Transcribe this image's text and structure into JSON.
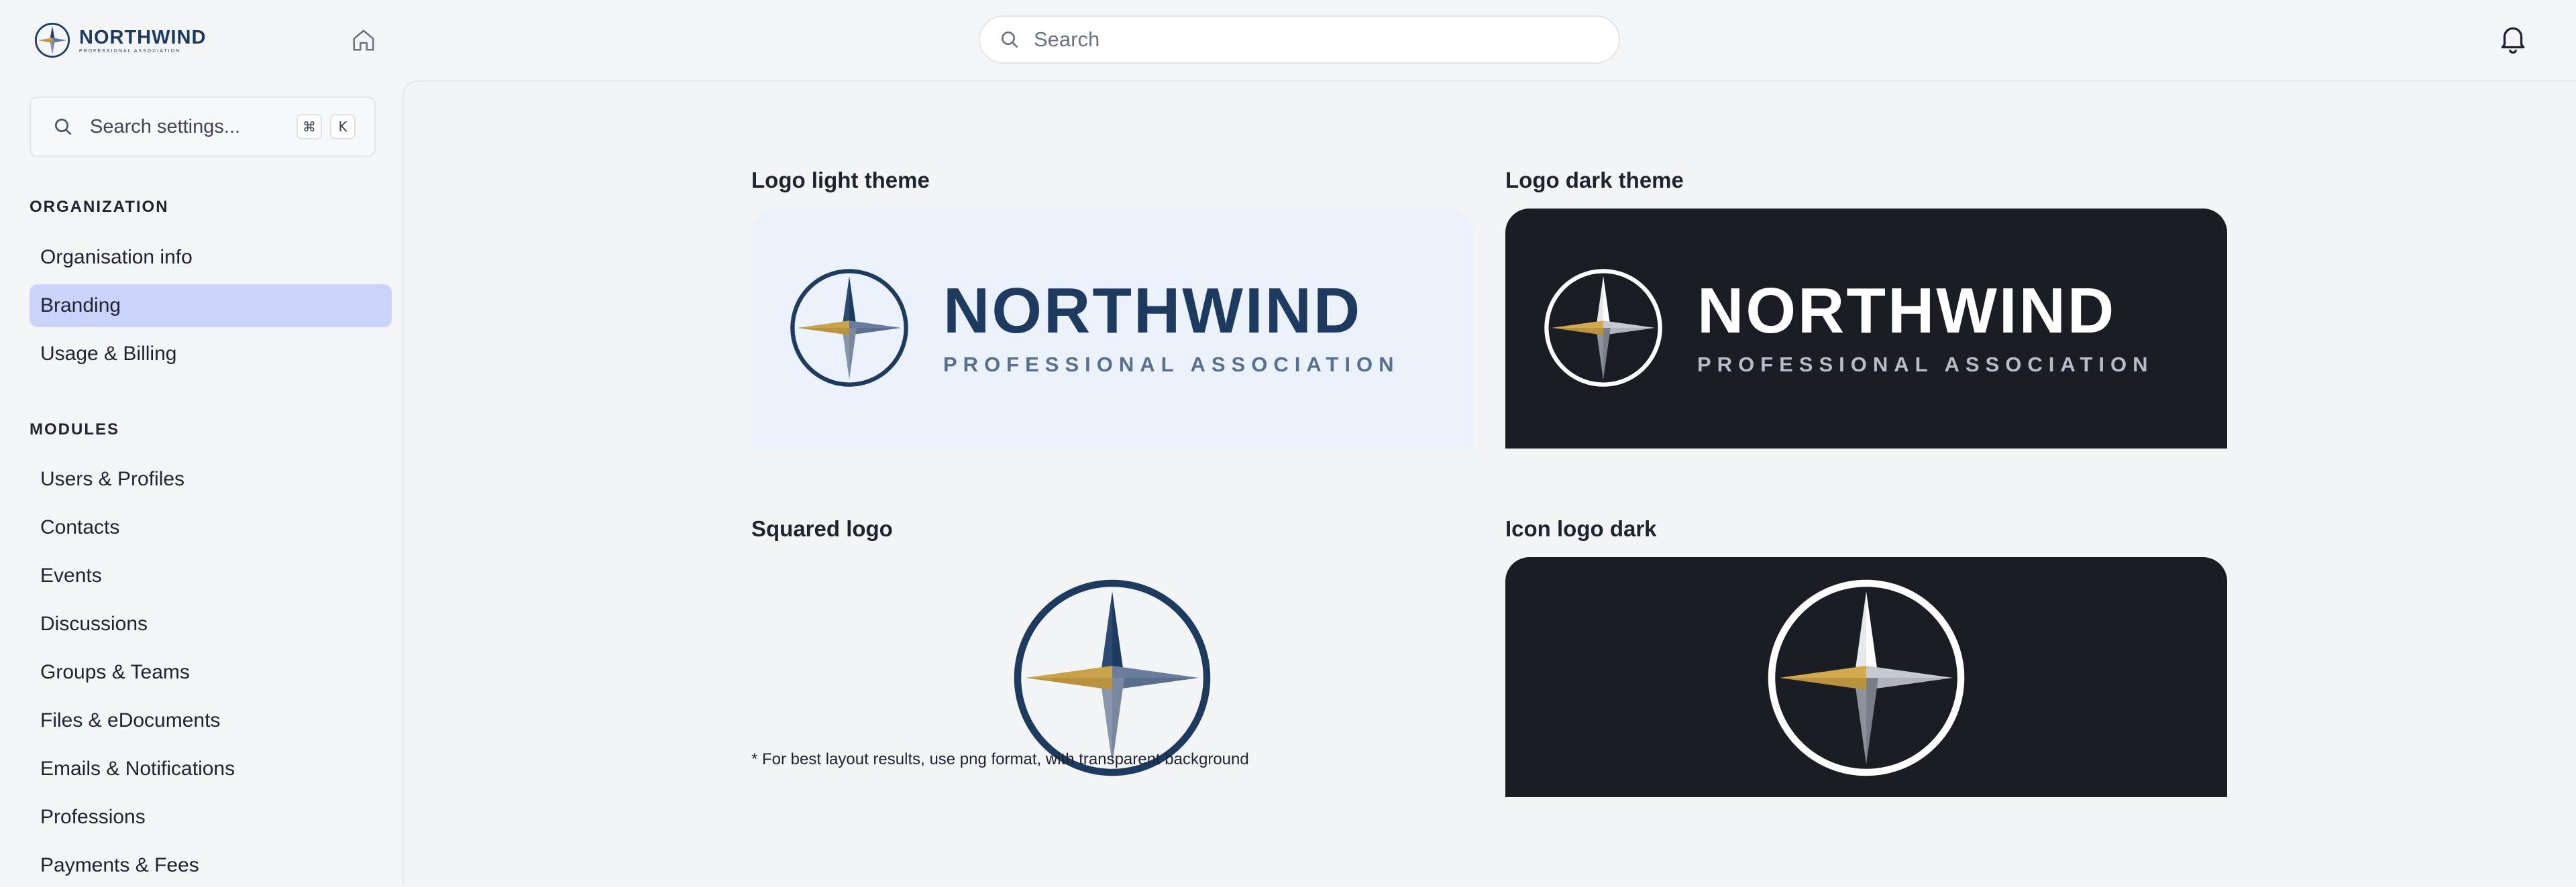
{
  "header": {
    "brand_name": "NORTHWIND",
    "brand_sub": "PROFESSIONAL ASSOCIATION",
    "search_placeholder": "Search"
  },
  "sidebar": {
    "search_placeholder": "Search settings...",
    "shortcut_cmd": "⌘",
    "shortcut_key": "K",
    "sections": [
      {
        "title": "ORGANIZATION",
        "items": [
          {
            "label": "Organisation info"
          },
          {
            "label": "Branding"
          },
          {
            "label": "Usage & Billing"
          }
        ]
      },
      {
        "title": "MODULES",
        "items": [
          {
            "label": "Users & Profiles"
          },
          {
            "label": "Contacts"
          },
          {
            "label": "Events"
          },
          {
            "label": "Discussions"
          },
          {
            "label": "Groups & Teams"
          },
          {
            "label": "Files & eDocuments"
          },
          {
            "label": "Emails & Notifications"
          },
          {
            "label": "Professions"
          },
          {
            "label": "Payments & Fees"
          }
        ]
      }
    ],
    "active_item": "Branding"
  },
  "branding": {
    "cards": [
      {
        "title": "Logo light theme",
        "name": "NORTHWIND",
        "sub": "PROFESSIONAL ASSOCIATION"
      },
      {
        "title": "Logo dark theme",
        "name": "NORTHWIND",
        "sub": "PROFESSIONAL ASSOCIATION"
      },
      {
        "title": "Squared logo"
      },
      {
        "title": "Icon logo dark"
      }
    ],
    "footnote": "* For best layout results, use png format, with transparent background"
  },
  "colors": {
    "navy": "#1e3a5f",
    "gold": "#c9a24a",
    "dark_bg": "#1a1d24",
    "light_bg": "#ebf2fc",
    "active_nav": "#ccd3fa"
  },
  "icons": [
    "compass-star-logo-icon",
    "home-icon",
    "search-icon",
    "bell-icon"
  ]
}
